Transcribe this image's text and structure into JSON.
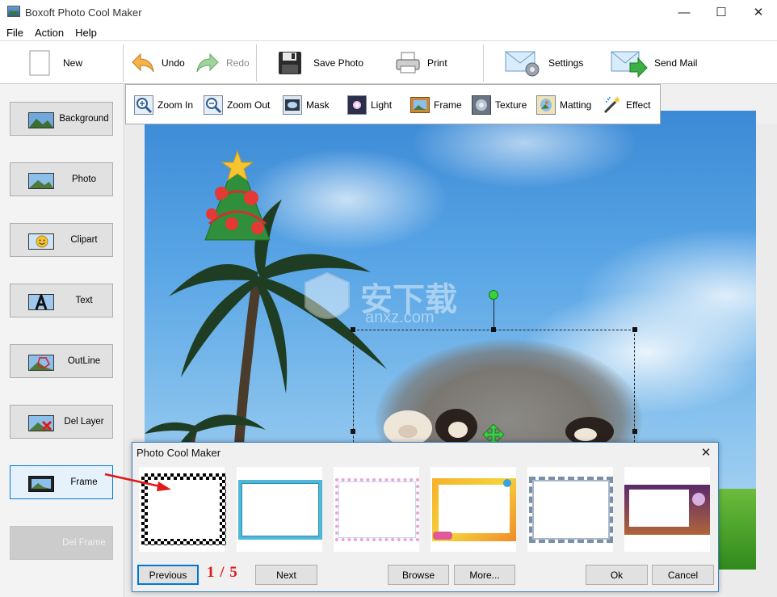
{
  "window": {
    "title": "Boxoft Photo Cool Maker",
    "controls": {
      "minimize": "—",
      "maximize": "☐",
      "close": "✕"
    }
  },
  "menu": {
    "items": [
      "File",
      "Action",
      "Help"
    ]
  },
  "toolbar": {
    "new_label": "New",
    "undo_label": "Undo",
    "redo_label": "Redo",
    "save_label": "Save Photo",
    "print_label": "Print",
    "settings_label": "Settings",
    "sendmail_label": "Send Mail"
  },
  "left_panel": {
    "background": "Background",
    "photo": "Photo",
    "clipart": "Clipart",
    "text": "Text",
    "outline": "OutLine",
    "del_layer": "Del Layer",
    "frame": "Frame",
    "del_frame": "Del Frame"
  },
  "tools": {
    "zoom_in": "Zoom In",
    "zoom_out": "Zoom Out",
    "mask": "Mask",
    "light": "Light",
    "frame": "Frame",
    "texture": "Texture",
    "matting": "Matting",
    "effect": "Effect"
  },
  "watermark": {
    "main": "安下载",
    "sub": "anxz.com"
  },
  "dialog": {
    "title": "Photo Cool Maker",
    "close": "✕",
    "page_indicator": "1 / 5",
    "previous_label": "Previous",
    "next_label": "Next",
    "browse_label": "Browse",
    "more_label": "More...",
    "ok_label": "Ok",
    "cancel_label": "Cancel"
  },
  "colors": {
    "accent": "#0078d7",
    "indicator": "#e01919",
    "sky": "#5aa6e6"
  }
}
